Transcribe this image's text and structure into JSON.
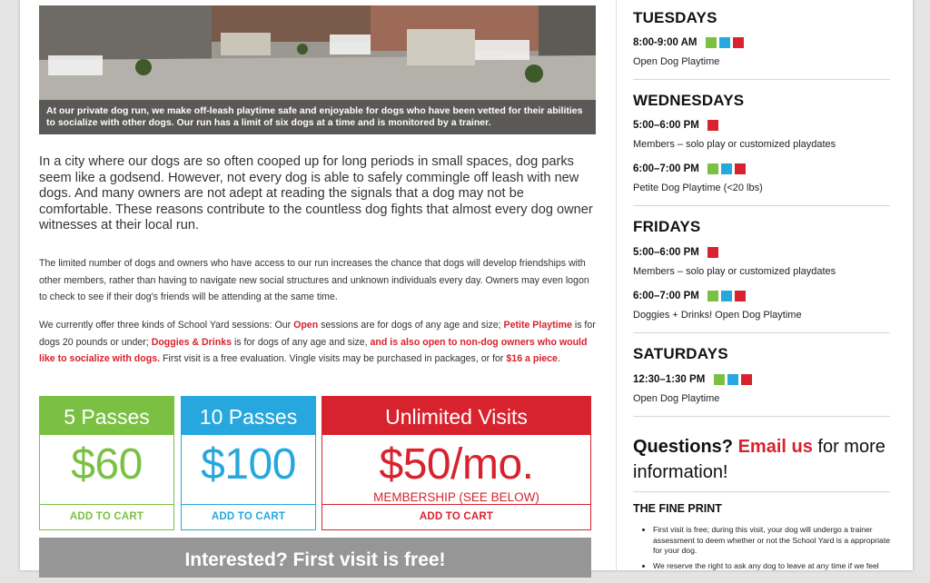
{
  "photo": {
    "caption": "At our private dog run, we make off-leash playtime safe and enjoyable for dogs who have been vetted for their abilities to socialize with other dogs. Our run has a limit of six dogs at a time and is monitored by a trainer."
  },
  "content": {
    "lead": "In a city where our dogs are so often cooped up for long periods in small spaces, dog parks seem like a godsend. However, not every dog is able to safely commingle off leash with new dogs. And many owners are not adept at reading the signals that a dog may not be comfortable. These reasons contribute to the countless dog fights that almost every dog owner witnesses at their local run.",
    "p1": "The limited number of dogs and owners who have access to our run increases the chance that dogs will develop friendships with other members, rather than having to navigate new social structures and unknown individuals every day. Owners may even logon to check to see if their dog's friends will be attending at the same time.",
    "p2": {
      "t1": "We currently offer three kinds of School Yard sessions: Our ",
      "open": "Open",
      "t2": " sessions are for dogs of any age and size; ",
      "petite": "Petite Playtime",
      "t3": " is for dogs 20 pounds or under; ",
      "doggies": "Doggies & Drinks",
      "t4": " is for dogs of any age and size, ",
      "nondog": "and is also open to non-dog owners who would like to socialize with dogs.",
      "t5": " First visit is a free evaluation. Vingle visits may be purchased in packages, or for ",
      "piece": "$16 a piece",
      "t6": "."
    }
  },
  "pricing": [
    {
      "title": "5 Passes",
      "price": "$60",
      "cart": "ADD TO CART"
    },
    {
      "title": "10 Passes",
      "price": "$100",
      "cart": "ADD TO CART"
    },
    {
      "title": "Unlimited Visits",
      "price": "$50/mo.",
      "sub": "MEMBERSHIP (SEE BELOW)",
      "cart": "ADD TO CART"
    }
  ],
  "banner": "Interested? First visit is free!",
  "schedule": {
    "tue": {
      "day": "TUESDAYS",
      "slots": [
        {
          "time": "8:00-9:00 AM",
          "desc": "Open Dog Playtime"
        }
      ]
    },
    "wed": {
      "day": "WEDNESDAYS",
      "slots": [
        {
          "time": "5:00–6:00 PM",
          "desc": "Members – solo play or customized playdates"
        },
        {
          "time": "6:00–7:00 PM",
          "desc": "Petite Dog Playtime (<20 lbs)"
        }
      ]
    },
    "fri": {
      "day": "FRIDAYS",
      "slots": [
        {
          "time": "5:00–6:00 PM",
          "desc": "Members – solo play or customized playdates"
        },
        {
          "time": "6:00–7:00 PM",
          "desc": "Doggies + Drinks! Open Dog Playtime"
        }
      ]
    },
    "sat": {
      "day": "SATURDAYS",
      "slots": [
        {
          "time": "12:30–1:30 PM",
          "desc": "Open Dog Playtime"
        }
      ]
    }
  },
  "questions": {
    "q": "Questions?",
    "email": "Email us",
    "rest": " for more information!"
  },
  "fine_print": {
    "title": "THE FINE PRINT",
    "items": [
      "First visit is free; during this visit, your dog will undergo a trainer assessment to deem whether or not the School Yard is a appropriate for your dog.",
      "We reserve the right to ask any dog to leave at any time if we feel"
    ]
  },
  "colors": {
    "green": "#7ac143",
    "blue": "#26a7de",
    "red": "#d8222e",
    "banner_gray": "#969696"
  }
}
